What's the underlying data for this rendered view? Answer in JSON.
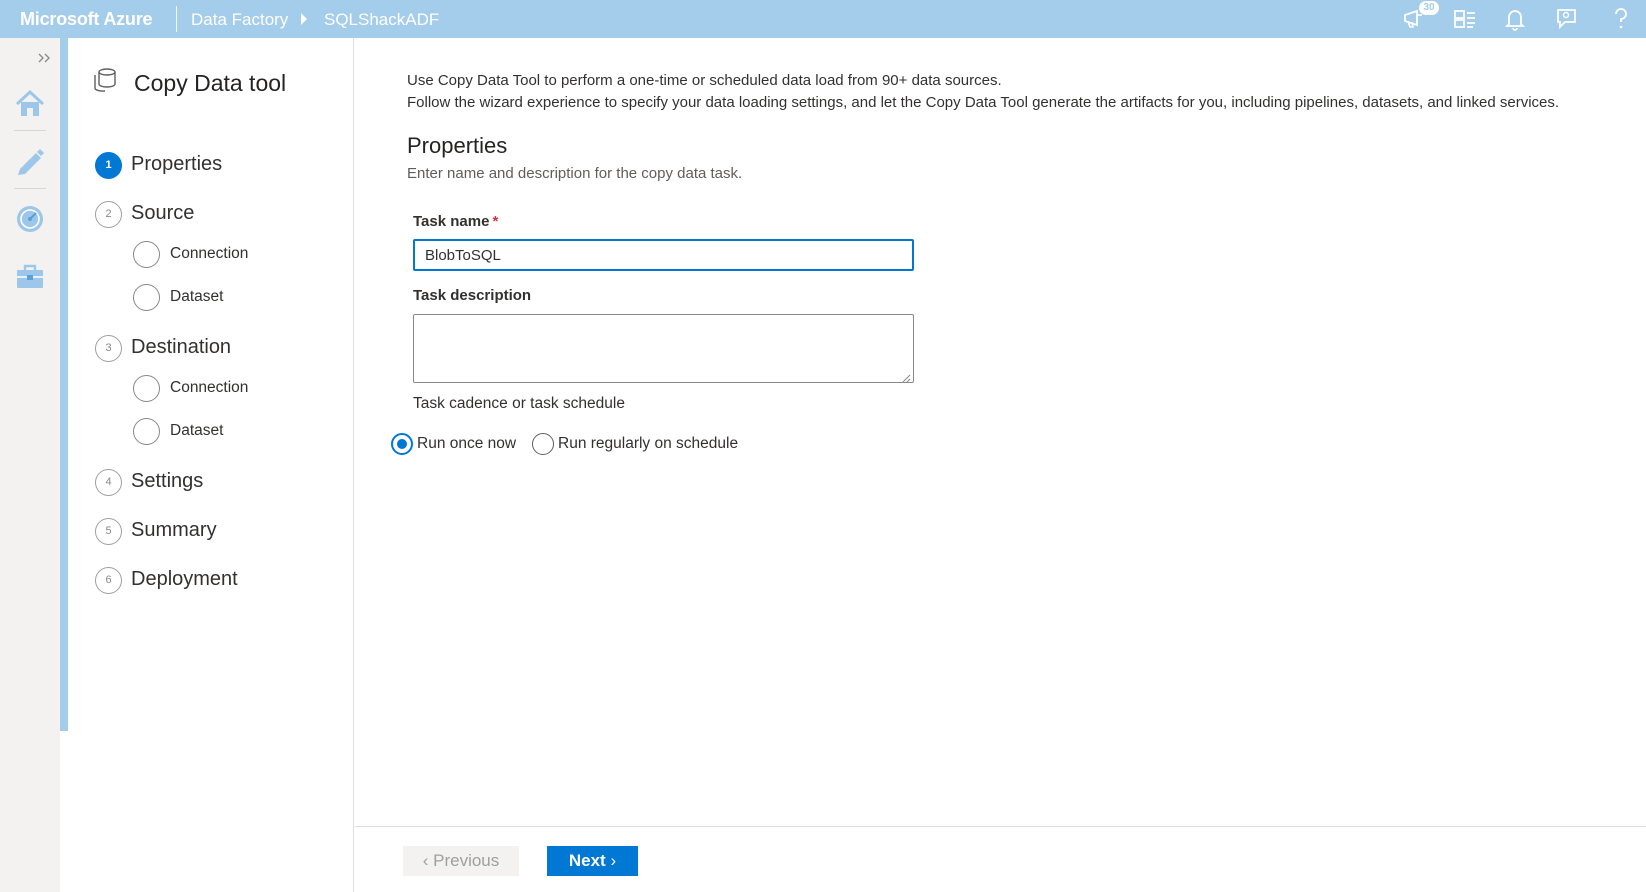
{
  "topbar": {
    "brand": "Microsoft Azure",
    "breadcrumb": [
      "Data Factory",
      "SQLShackADF"
    ],
    "notification_count": "30",
    "icons": [
      "feedback-icon",
      "directory-filter-icon",
      "bell-icon",
      "chat-icon",
      "help-icon"
    ],
    "bg_color": "#a4cdec"
  },
  "rail": {
    "expand_icon": "double-chevron-right-icon",
    "items": [
      {
        "name": "home-icon"
      },
      {
        "name": "author-pencil-icon"
      },
      {
        "name": "monitor-gauge-icon"
      },
      {
        "name": "manage-toolbox-icon"
      }
    ]
  },
  "wizard": {
    "title": "Copy Data tool",
    "steps": [
      {
        "num": "1",
        "label": "Properties",
        "active": true
      },
      {
        "num": "2",
        "label": "Source",
        "substeps": [
          "Connection",
          "Dataset"
        ]
      },
      {
        "num": "3",
        "label": "Destination",
        "substeps": [
          "Connection",
          "Dataset"
        ]
      },
      {
        "num": "4",
        "label": "Settings"
      },
      {
        "num": "5",
        "label": "Summary"
      },
      {
        "num": "6",
        "label": "Deployment"
      }
    ]
  },
  "main": {
    "intro_line1": "Use Copy Data Tool to perform a one-time or scheduled data load from 90+ data sources.",
    "intro_line2": "Follow the wizard experience to specify your data loading settings, and let the Copy Data Tool generate the artifacts for you, including pipelines, datasets, and linked services.",
    "section_title": "Properties",
    "section_subtitle": "Enter name and description for the copy data task.",
    "task_name_label": "Task name",
    "required_marker": "*",
    "task_name_value": "BlobToSQL",
    "task_description_label": "Task description",
    "task_description_value": "",
    "cadence_label": "Task cadence or task schedule",
    "cadence_options": [
      {
        "label": "Run once now",
        "selected": true
      },
      {
        "label": "Run regularly on schedule",
        "selected": false
      }
    ]
  },
  "footer": {
    "previous_label": "Previous",
    "next_label": "Next",
    "accent_color": "#0078d4"
  }
}
